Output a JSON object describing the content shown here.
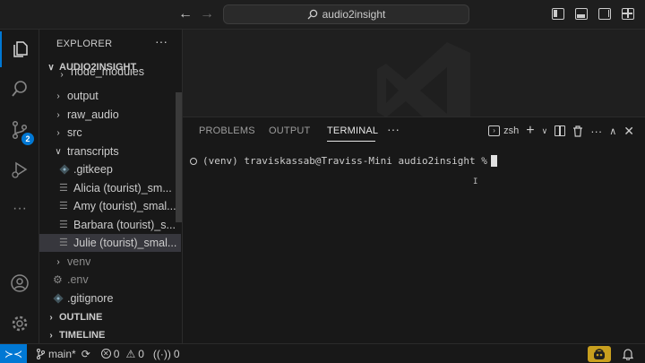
{
  "titlebar": {
    "search_label": "audio2insight",
    "back_icon": "arrow-left-icon",
    "forward_icon": "arrow-right-icon"
  },
  "activity": {
    "source_control_badge": "2"
  },
  "sidebar": {
    "header": "EXPLORER",
    "more": "···",
    "workspace": "AUDIO2INSIGHT",
    "items": [
      {
        "label": "node_modules",
        "kind": "folder",
        "expanded": false
      },
      {
        "label": "output",
        "kind": "folder",
        "expanded": false
      },
      {
        "label": "raw_audio",
        "kind": "folder",
        "expanded": false
      },
      {
        "label": "src",
        "kind": "folder",
        "expanded": false
      },
      {
        "label": "transcripts",
        "kind": "folder",
        "expanded": true
      },
      {
        "label": ".gitkeep",
        "kind": "file"
      },
      {
        "label": "Alicia (tourist)_sm...",
        "kind": "file"
      },
      {
        "label": "Amy (tourist)_smal...",
        "kind": "file"
      },
      {
        "label": "Barbara (tourist)_s...",
        "kind": "file"
      },
      {
        "label": "Julie (tourist)_smal...",
        "kind": "file"
      },
      {
        "label": "venv",
        "kind": "folder",
        "expanded": false
      },
      {
        "label": ".env",
        "kind": "file"
      },
      {
        "label": ".gitignore",
        "kind": "file"
      }
    ],
    "outline": "OUTLINE",
    "timeline": "TIMELINE"
  },
  "panel": {
    "tabs": [
      "PROBLEMS",
      "OUTPUT",
      "TERMINAL"
    ],
    "more": "···",
    "shell": "zsh",
    "prompt": "(venv) traviskassab@Traviss-Mini audio2insight %"
  },
  "statusbar": {
    "branch": "main*",
    "errors": "0",
    "warnings": "0",
    "ports": "0"
  },
  "colors": {
    "accent": "#0078d4",
    "background": "#1f1f1f",
    "sidebar": "#181818",
    "copilot": "#c89f1e"
  }
}
